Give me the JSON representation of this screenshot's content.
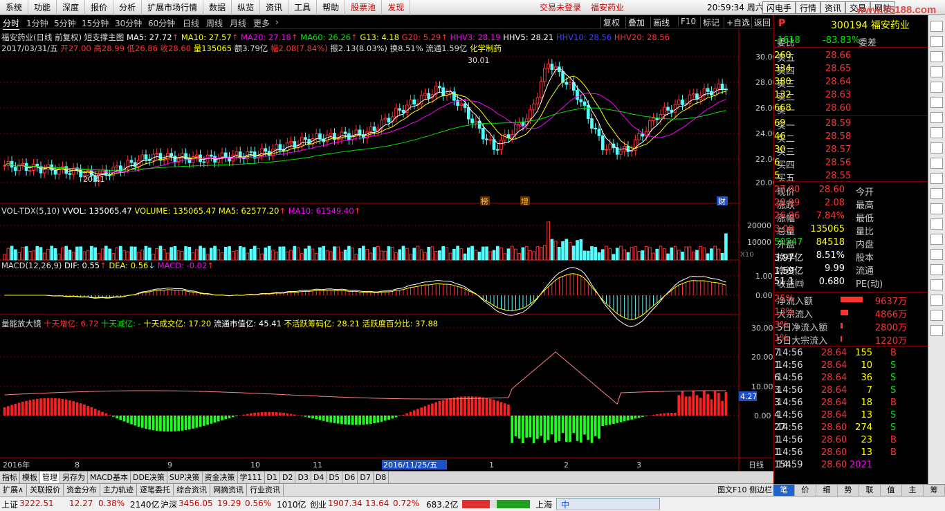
{
  "menubar": {
    "items": [
      "系统",
      "功能",
      "深度",
      "报价",
      "分析",
      "扩展市场行情",
      "数据",
      "纵览",
      "资讯",
      "工具",
      "帮助"
    ],
    "stock_pool": "股票池",
    "discover": "发现",
    "trade_status": "交易未登录",
    "stock_short": "福安药业",
    "clock": "20:59:34",
    "weekday": "周六",
    "right_buttons": [
      "闪电手",
      "行情",
      "资讯",
      "交易",
      "网站"
    ],
    "watermark": "www.55188.com"
  },
  "period_bar": {
    "items": [
      "分时",
      "1分钟",
      "5分钟",
      "15分钟",
      "30分钟",
      "60分钟",
      "日线",
      "周线",
      "月线",
      "更多"
    ],
    "active": "分时",
    "tools": [
      "复权",
      "叠加",
      "画线",
      "F10",
      "标记",
      "+自选",
      "返回"
    ]
  },
  "main_chart": {
    "header1": {
      "name": "福安药业(日线 前复权) 短支撑主图",
      "ma5": "MA5: 27.72",
      "ma10": "MA10: 27.57",
      "ma20": "MA20: 27.18",
      "ma60": "MA60: 26.26",
      "g13": "G13: 4.18",
      "g20": "G20: 5.29",
      "hhv3": "HHV3: 28.19",
      "hhv5": "HHV5: 28.21",
      "hhv10": "HHV10: 28.56",
      "hhv20": "HHV20: 28.56"
    },
    "header2": {
      "date": "2017/03/31/五",
      "open": "开27.00",
      "high": "高28.99",
      "low": "低26.86",
      "close": "收28.60",
      "vol": "量135065",
      "amt": "额3.79亿",
      "chg": "幅2.08(7.84%)",
      "amp": "振2.13(8.03%)",
      "turn": "换8.51%",
      "float": "流通1.59亿",
      "sector": "化学制药"
    },
    "y_ticks": [
      "30.00",
      "28.00",
      "26.00",
      "24.00",
      "22.00",
      "20.00"
    ],
    "annotations": {
      "high": "30.01",
      "low": "20.41"
    },
    "event_tags": [
      "榜",
      "增",
      "财"
    ]
  },
  "volume_chart": {
    "title": "VOL-TDX(5,10)",
    "vvol": "VVOL: 135065.47",
    "volume": "VOLUME: 135065.47",
    "ma5": "MA5: 62577.20",
    "ma10": "MA10: 61549.40",
    "y_ticks": [
      "20000",
      "10000"
    ],
    "unit": "X10"
  },
  "macd_chart": {
    "title": "MACD(12,26,9)",
    "dif": "DIF: 0.55",
    "dea": "DEA: 0.56",
    "macd": "MACD: -0.02",
    "y_ticks": [
      "1.00",
      "0.00"
    ]
  },
  "amp_chart": {
    "title": "量能放大镜",
    "s1": "十天增亿: 6.72",
    "s2": "十天减亿: -",
    "s3": "十天成交亿: 17.20",
    "s4": "流通市值亿: 45.41",
    "s5": "不活跃筹码亿: 28.21",
    "s6": "活跃度百分比: 37.88",
    "y_ticks": [
      "30.00",
      "20.00",
      "10.00",
      "0.00"
    ],
    "current": "4.27"
  },
  "x_axis": {
    "labels": [
      "2016年",
      "8",
      "9",
      "10",
      "11",
      "2016/11/25/五",
      "1",
      "2",
      "3"
    ],
    "period": "日线"
  },
  "bottom_tabs": [
    "指标",
    "模板",
    "管理",
    "另存为",
    "MACD基本",
    "DDE决策",
    "SUP决策",
    "资金决策",
    "学111",
    "D1",
    "D2",
    "D3",
    "D4",
    "D5",
    "D6",
    "D7",
    "D8"
  ],
  "bottom_tabs2": [
    "扩展∧",
    "关联报价",
    "资金分布",
    "主力轨迹",
    "逐笔委托",
    "综合资讯",
    "网摘资讯",
    "行业资讯"
  ],
  "bottom_tabs2_right": [
    "图文F10",
    "侧边栏"
  ],
  "quote": {
    "code": "300194",
    "name": "福安药业",
    "wb_label": "委比",
    "wb": "-83.83%",
    "wc_label": "委差",
    "wc": "-1618",
    "asks": [
      {
        "l": "卖五",
        "p": "28.66",
        "v": "260"
      },
      {
        "l": "卖四",
        "p": "28.65",
        "v": "334"
      },
      {
        "l": "卖三",
        "p": "28.64",
        "v": "380"
      },
      {
        "l": "卖二",
        "p": "28.63",
        "v": "132"
      },
      {
        "l": "卖一",
        "p": "28.60",
        "v": "668"
      }
    ],
    "bids": [
      {
        "l": "买一",
        "p": "28.59",
        "v": "69"
      },
      {
        "l": "买二",
        "p": "28.58",
        "v": "46"
      },
      {
        "l": "买三",
        "p": "28.57",
        "v": "30"
      },
      {
        "l": "买四",
        "p": "28.56",
        "v": "6"
      },
      {
        "l": "买五",
        "p": "28.55",
        "v": "5"
      }
    ],
    "stats": [
      [
        "现价",
        "28.60",
        "今开",
        "27.00"
      ],
      [
        "涨跌",
        "2.08",
        "最高",
        "28.99"
      ],
      [
        "涨幅",
        "7.84%",
        "最低",
        "26.86"
      ],
      [
        "总量",
        "135065",
        "量比",
        "3.09"
      ],
      [
        "外盘",
        "84518",
        "内盘",
        "50547"
      ],
      [
        "换手",
        "8.51%",
        "股本",
        "3.97亿"
      ],
      [
        "净资",
        "9.99",
        "流通",
        "1.59亿"
      ],
      [
        "收益㈣",
        "0.680",
        "PE(动)",
        "51.1"
      ]
    ],
    "flows": [
      [
        "净流入额",
        "9637万",
        "25%"
      ],
      [
        "大宗流入",
        "4866万",
        "13%"
      ],
      [
        "5日净流入额",
        "2800万",
        "3%"
      ],
      [
        "5日大宗流入",
        "1220万",
        "1%"
      ]
    ],
    "ticks": [
      [
        "14:56",
        "28.64",
        "155",
        "B",
        "7"
      ],
      [
        "14:56",
        "28.64",
        "10",
        "S",
        "1"
      ],
      [
        "14:56",
        "28.64",
        "36",
        "S",
        "6"
      ],
      [
        "14:56",
        "28.64",
        "7",
        "S",
        "3"
      ],
      [
        "14:56",
        "28.64",
        "18",
        "B",
        "3"
      ],
      [
        "14:56",
        "28.64",
        "13",
        "S",
        "4"
      ],
      [
        "14:56",
        "28.60",
        "274",
        "S",
        "27"
      ],
      [
        "14:56",
        "28.60",
        "23",
        "B",
        "1"
      ],
      [
        "14:56",
        "28.60",
        "13",
        "B",
        "1"
      ],
      [
        "14:59",
        "28.60",
        "2021",
        "",
        "154"
      ]
    ]
  },
  "right_tabs": [
    "笔",
    "价",
    "细",
    "势",
    "联",
    "值",
    "主",
    "筹"
  ],
  "statusbar": {
    "sh_label": "上证",
    "sh_val": "3222.51",
    "sh_chg": "12.27",
    "sh_pct": "0.38%",
    "sh_amt": "2140亿",
    "hs_label": "沪深",
    "hs_val": "3456.05",
    "hs_chg": "19.29",
    "hs_pct": "0.56%",
    "hs_amt": "1010亿",
    "cy_label": "创业",
    "cy_val": "1907.34",
    "cy_chg": "13.64",
    "cy_pct": "0.72%",
    "cy_amt": "683.2亿",
    "right_label": "上海",
    "right_icons": [
      "中"
    ]
  },
  "colors": {
    "up": "#ff3232",
    "down": "#54ffff",
    "ma5": "#ffffff",
    "ma10": "#ffff00",
    "ma20": "#ff00ff",
    "ma60": "#00e600",
    "grid": "#800000"
  }
}
